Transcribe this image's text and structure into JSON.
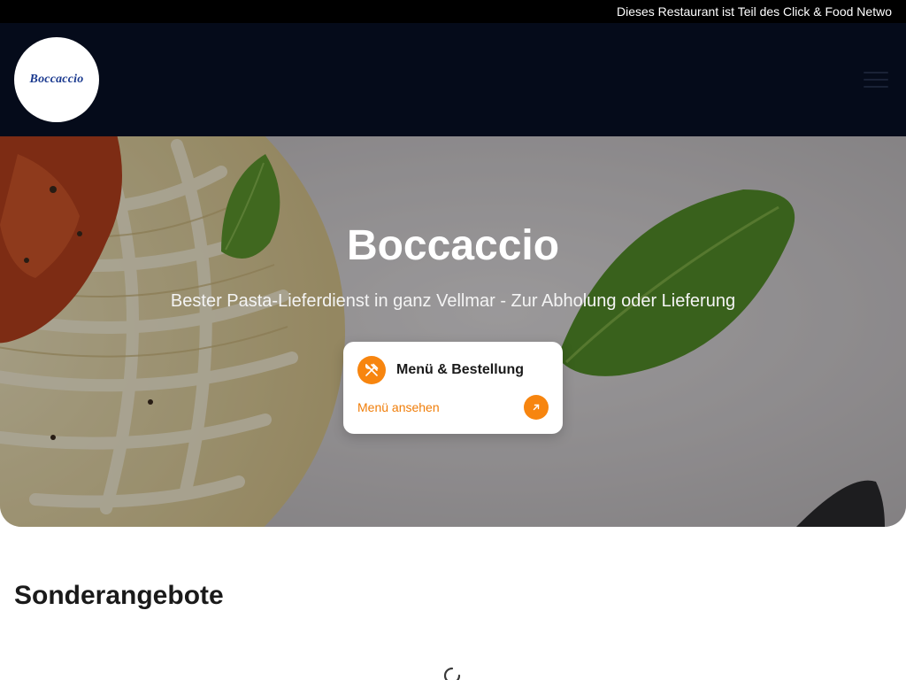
{
  "banner": {
    "text": "Dieses Restaurant ist Teil des Click & Food Netwo"
  },
  "header": {
    "logo_text": "Boccaccio",
    "menu_icon": "hamburger-menu-icon"
  },
  "hero": {
    "title": "Boccaccio",
    "subtitle": "Bester Pasta-Lieferdienst in ganz Vellmar - Zur Abholung oder Lieferung",
    "card": {
      "icon": "cutlery-icon",
      "title": "Menü & Bestellung",
      "link_label": "Menü ansehen",
      "arrow_icon": "arrow-up-right-icon"
    }
  },
  "offers": {
    "title": "Sonderangebote",
    "loading_icon": "loading-spinner-icon"
  },
  "colors": {
    "accent": "#f7850f",
    "header_bg": "#050b1a",
    "banner_bg": "#000000",
    "logo_text": "#1b3a8f"
  }
}
